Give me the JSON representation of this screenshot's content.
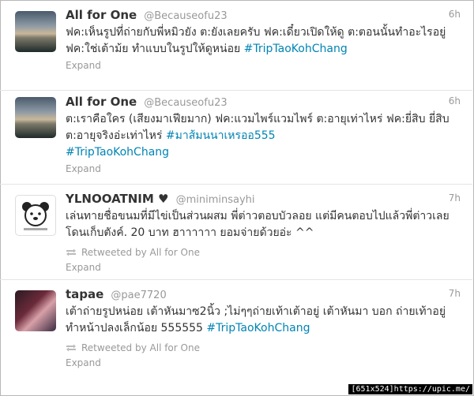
{
  "tweets": [
    {
      "fullname": "All for One",
      "handle": "@Becauseofu23",
      "time": "6h",
      "text": "ฟค:เห็นรูปที่ถ่ายกับพี่หมิวยัง ต:ยังเลยครับ ฟค:เดี๋ยวเปิดให้ดู ต:ตอนนั้นทำอะไรอยู่ ฟค:ใช่เต้าม้ย ทำแบบในรูปให้ดูหน่อย ",
      "hashtag": "#TripTaoKohChang",
      "expand": "Expand"
    },
    {
      "fullname": "All for One",
      "handle": "@Becauseofu23",
      "time": "6h",
      "text": "ต:เราคือใคร (เสียงมาเฟียมาก) ฟค:แวมไพร์แวมไพร์ ต:อายุเท่าไหร่ ฟค:ยี่สิบ ยี่สิบ ต:อายุจริงอ่ะเท่าไหร่ ",
      "hashtag": "#มาส้มนนาเหรออ555",
      "hashtag2": "#TripTaoKohChang",
      "expand": "Expand"
    },
    {
      "fullname": "YLNOOATNIM ♥",
      "handle": "@miniminsayhi",
      "time": "7h",
      "text": "เล่นทายชื่อขนมที่มีไข่เป็นส่วนผสม พี่ต่าวตอบบัวลอย แต่มีคนตอบไปแล้วพี่ต่าวเลยโดนเก็บตังค์. 20 บาท ฮาาาาาา ยอมจ่ายด้วยอ่ะ ^^",
      "retweet": "Retweeted by All for One",
      "expand": "Expand"
    },
    {
      "fullname": "tapae",
      "handle": "@pae7720",
      "time": "7h",
      "text": "เต้าถ่ายรูปหน่อย เต้าหันมาซ2นิ้ว ;ไม่ๆๆถ่ายเท้าเต้าอยู่ เต้าหันมา บอก ถ่ายเท้าอยู่ ทำหน้าปลงเล็กน้อย 555555 ",
      "hashtag": "#TripTaoKohChang",
      "retweet": "Retweeted by All for One",
      "expand": "Expand"
    }
  ],
  "watermark": "[651x524]https://upic.me/"
}
